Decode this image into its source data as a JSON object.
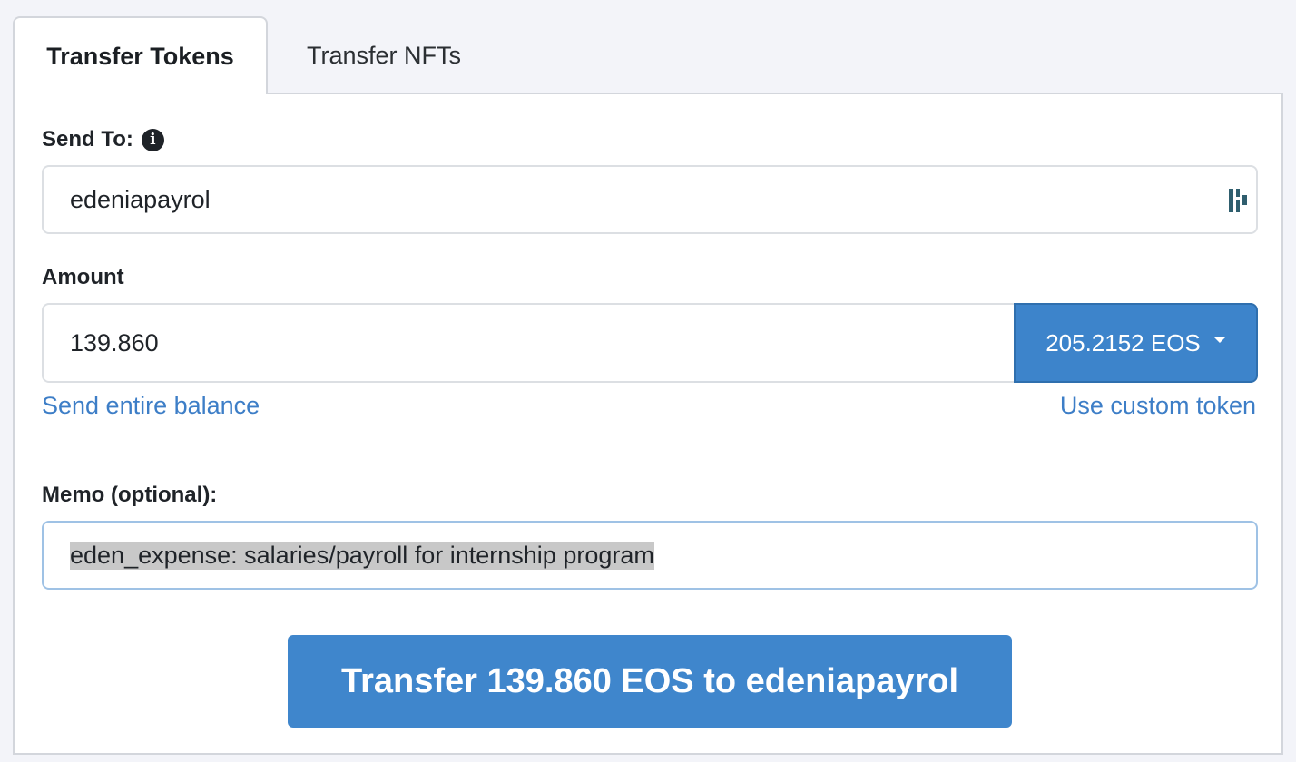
{
  "tabs": {
    "transfer_tokens": "Transfer Tokens",
    "transfer_nfts": "Transfer NFTs"
  },
  "send_to": {
    "label": "Send To:",
    "info_icon": "info-circle-icon",
    "value": "edeniapayrol",
    "scan_icon": "address-scan-icon"
  },
  "amount": {
    "label": "Amount",
    "value": "139.860",
    "token_balance": "205.2152 EOS",
    "send_entire_balance": "Send entire balance",
    "use_custom_token": "Use custom token"
  },
  "memo": {
    "label": "Memo (optional):",
    "value": "eden_expense: salaries/payroll for internship program"
  },
  "submit": {
    "label": "Transfer 139.860 EOS to edeniapayrol"
  },
  "colors": {
    "accent": "#3d84cb",
    "link": "#3d7ec7",
    "background": "#f3f4f9"
  }
}
